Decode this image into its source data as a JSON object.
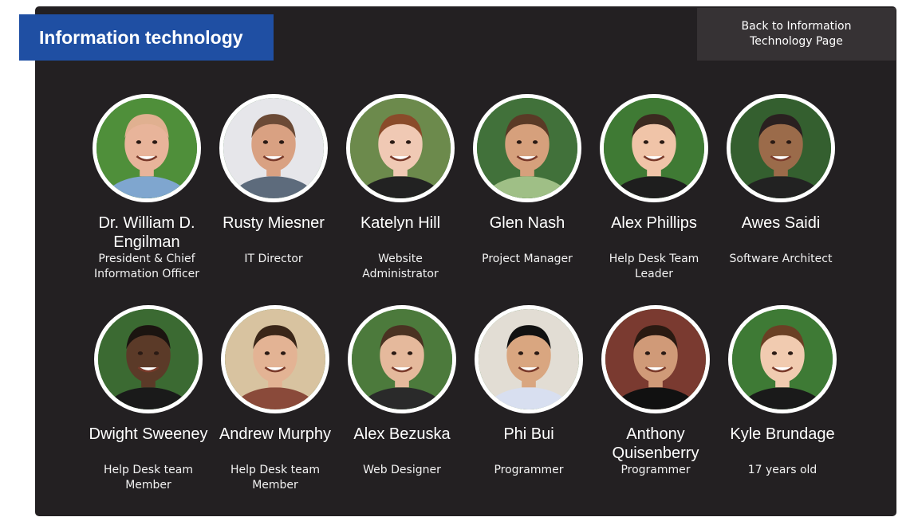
{
  "header": {
    "title": "Information technology",
    "back_label": "Back to Information Technology Page"
  },
  "colors": {
    "title_bg": "#1f4fa3",
    "panel_bg": "#232022",
    "back_bg": "#363234"
  },
  "members": [
    {
      "name": "Dr. William D. Engilman",
      "role": "President & Chief Information Officer",
      "photo": {
        "bg": "#4f8f3a",
        "skin": "#e8b49a",
        "hair": "#e0b090",
        "shirt": "#7fa6cf"
      }
    },
    {
      "name": "Rusty Miesner",
      "role": "IT Director",
      "photo": {
        "bg": "#e6e6ea",
        "skin": "#d9a182",
        "hair": "#6b4a36",
        "shirt": "#5d6b7c"
      }
    },
    {
      "name": "Katelyn Hill",
      "role": "Website Administrator",
      "photo": {
        "bg": "#6c8a4c",
        "skin": "#f0c9b4",
        "hair": "#8a4b2a",
        "shirt": "#222222"
      }
    },
    {
      "name": "Glen Nash",
      "role": "Project Manager",
      "photo": {
        "bg": "#41713a",
        "skin": "#d6a07c",
        "hair": "#5a3a26",
        "shirt": "#9fbf86"
      }
    },
    {
      "name": "Alex Phillips",
      "role": "Help Desk Team Leader",
      "photo": {
        "bg": "#3f7a34",
        "skin": "#f0c4a8",
        "hair": "#3b2a20",
        "shirt": "#1e1e1e"
      }
    },
    {
      "name": "Awes Saidi",
      "role": "Software Architect",
      "photo": {
        "bg": "#345f2f",
        "skin": "#9b6b4a",
        "hair": "#2a2020",
        "shirt": "#222222"
      }
    },
    {
      "name": "Dwight Sweeney",
      "role": "Help Desk team Member",
      "photo": {
        "bg": "#3b6a32",
        "skin": "#5b3a28",
        "hair": "#1b1410",
        "shirt": "#1a1a1a"
      }
    },
    {
      "name": "Andrew Murphy",
      "role": "Help Desk team Member",
      "photo": {
        "bg": "#d8c3a0",
        "skin": "#e3b394",
        "hair": "#3a2618",
        "shirt": "#8a4a3a"
      }
    },
    {
      "name": "Alex Bezuska",
      "role": "Web Designer",
      "photo": {
        "bg": "#4c7a3c",
        "skin": "#e5b99c",
        "hair": "#4a3222",
        "shirt": "#2a2a2a"
      }
    },
    {
      "name": "Phi Bui",
      "role": "Programmer",
      "photo": {
        "bg": "#e2ddd4",
        "skin": "#d9a680",
        "hair": "#111111",
        "shirt": "#d8dff0"
      }
    },
    {
      "name": "Anthony Quisenberry",
      "role": "Programmer",
      "photo": {
        "bg": "#7a3a30",
        "skin": "#d09a78",
        "hair": "#2a1a12",
        "shirt": "#111111"
      }
    },
    {
      "name": "Kyle Brundage",
      "role": "17 years old",
      "photo": {
        "bg": "#3e7a35",
        "skin": "#f1cbb0",
        "hair": "#6a4024",
        "shirt": "#1a1a1a"
      }
    }
  ]
}
